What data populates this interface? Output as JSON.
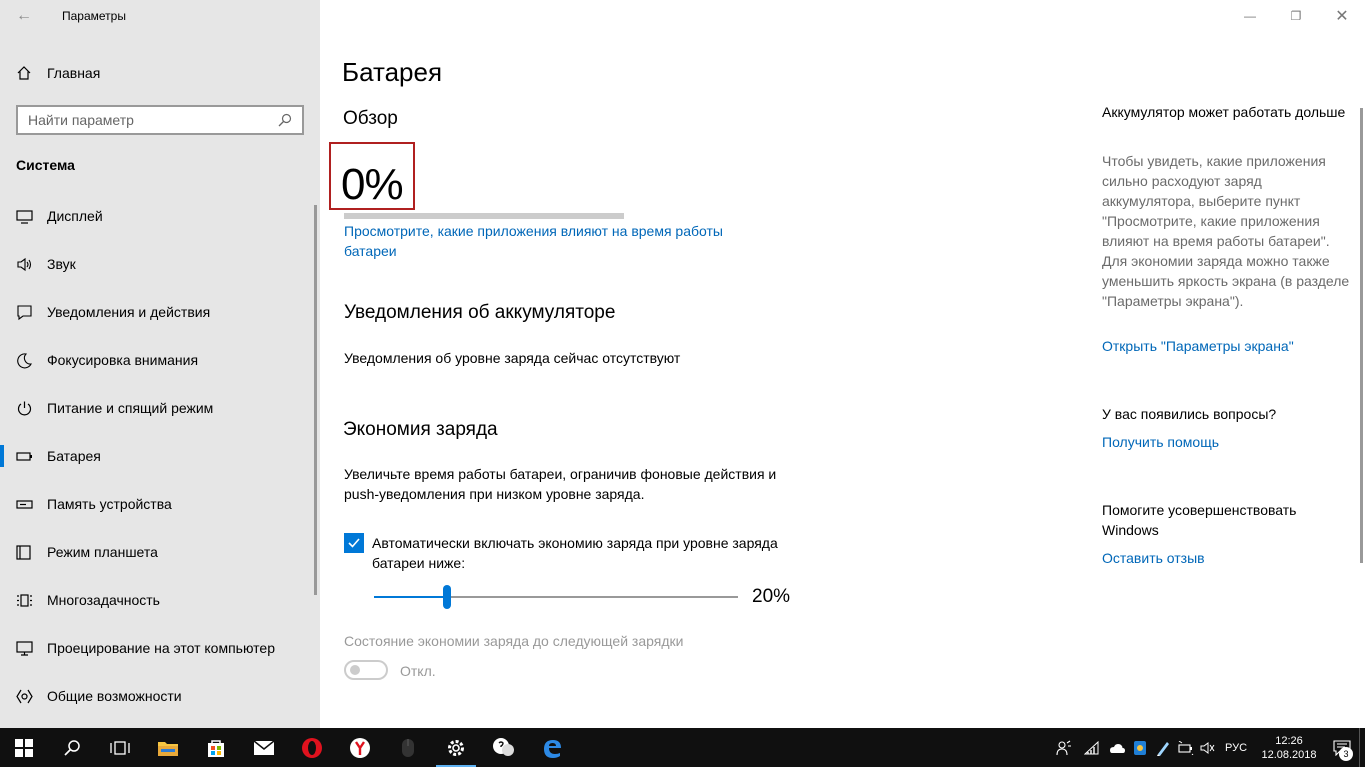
{
  "window": {
    "app_title": "Параметры",
    "minimize": "—",
    "maximize": "❐",
    "close": "✕"
  },
  "sidebar": {
    "home_label": "Главная",
    "search_placeholder": "Найти параметр",
    "section_label": "Система",
    "items": [
      {
        "label": "Дисплей",
        "icon": "display-icon"
      },
      {
        "label": "Звук",
        "icon": "speaker-icon"
      },
      {
        "label": "Уведомления и действия",
        "icon": "notification-icon"
      },
      {
        "label": "Фокусировка внимания",
        "icon": "moon-icon"
      },
      {
        "label": "Питание и спящий режим",
        "icon": "power-icon"
      },
      {
        "label": "Батарея",
        "icon": "battery-icon",
        "active": true
      },
      {
        "label": "Память устройства",
        "icon": "storage-icon"
      },
      {
        "label": "Режим планшета",
        "icon": "tablet-icon"
      },
      {
        "label": "Многозадачность",
        "icon": "multitasking-icon"
      },
      {
        "label": "Проецирование на этот компьютер",
        "icon": "projection-icon"
      },
      {
        "label": "Общие возможности",
        "icon": "shared-experiences-icon"
      }
    ]
  },
  "main": {
    "title": "Батарея",
    "overview": {
      "heading": "Обзор",
      "percent_text": "0%",
      "charge_fraction": 0.0,
      "apps_link": "Просмотрите, какие приложения влияют на время работы батареи"
    },
    "notifications": {
      "heading": "Уведомления об аккумуляторе",
      "text": "Уведомления об уровне заряда сейчас отсутствуют"
    },
    "saver": {
      "heading": "Экономия заряда",
      "description": "Увеличьте время работы батареи, ограничив фоновые действия и push-уведомления при низком уровне заряда.",
      "checkbox_label": "Автоматически включать экономию заряда при уровне заряда батареи ниже:",
      "checkbox_checked": true,
      "slider_value": 20,
      "slider_text": "20%",
      "status_label": "Состояние экономии заряда до следующей зарядки",
      "toggle_text": "Откл."
    }
  },
  "aside": {
    "tip_title": "Аккумулятор может работать дольше",
    "tip_text": "Чтобы увидеть, какие приложения сильно расходуют заряд аккумулятора, выберите пункт \"Просмотрите, какие приложения влияют на время работы батареи\". Для экономии заряда можно также уменьшить яркость экрана (в разделе \"Параметры экрана\").",
    "display_link": "Открыть \"Параметры экрана\"",
    "questions_title": "У вас появились вопросы?",
    "help_link": "Получить помощь",
    "improve_title": "Помогите усовершенствовать Windows",
    "feedback_link": "Оставить отзыв"
  },
  "taskbar": {
    "language": "РУС",
    "time": "12:26",
    "date": "12.08.2018",
    "notification_count": "3",
    "accent": "#0078d7"
  }
}
